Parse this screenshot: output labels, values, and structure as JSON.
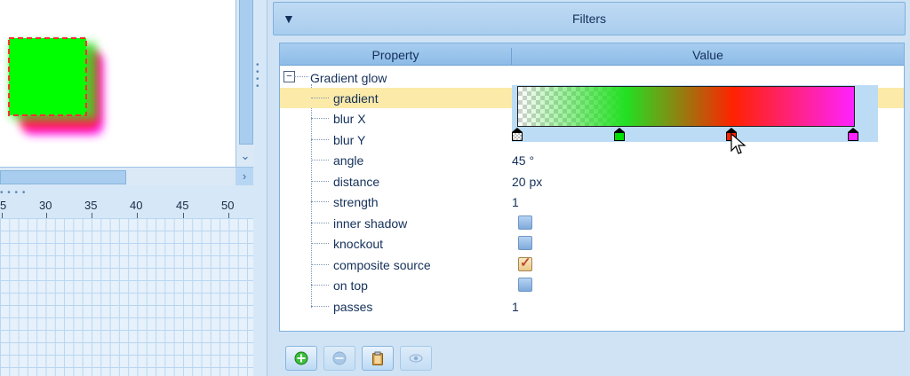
{
  "canvas": {
    "rect_fill": "#00ff00",
    "rect_border": "#ff3030",
    "glow_colors": [
      "#00ff00",
      "#ff2200",
      "#ff22ff"
    ]
  },
  "ruler": {
    "ticks": [
      "5",
      "30",
      "35",
      "40",
      "45",
      "50"
    ]
  },
  "filters_panel": {
    "title": "Filters",
    "collapse_icon": "triangle-down-icon"
  },
  "table": {
    "columns": [
      "Property",
      "Value"
    ],
    "group": {
      "label": "Gradient glow",
      "toggle": "−"
    },
    "rows": [
      {
        "label": "gradient",
        "value": "",
        "selected": true
      },
      {
        "label": "blur X",
        "value": ""
      },
      {
        "label": "blur Y",
        "value": ""
      },
      {
        "label": "angle",
        "value": "45 °"
      },
      {
        "label": "distance",
        "value": "20 px"
      },
      {
        "label": "strength",
        "value": "1"
      },
      {
        "label": "inner shadow",
        "checkbox": false
      },
      {
        "label": "knockout",
        "checkbox": false
      },
      {
        "label": "composite source",
        "checkbox": true
      },
      {
        "label": "on top",
        "checkbox": false
      },
      {
        "label": "passes",
        "value": "1"
      }
    ]
  },
  "gradient_editor": {
    "stops": [
      {
        "color": "transparent",
        "position": 0.0
      },
      {
        "color": "#00e000",
        "position": 0.32
      },
      {
        "color": "#ff2200",
        "position": 0.64
      },
      {
        "color": "#ff22ff",
        "position": 1.0
      }
    ]
  },
  "toolbar": {
    "buttons": [
      {
        "name": "add-filter-button",
        "icon": "plus-circle-icon",
        "enabled": true
      },
      {
        "name": "remove-filter-button",
        "icon": "minus-circle-icon",
        "enabled": false
      },
      {
        "name": "paste-filter-button",
        "icon": "clipboard-icon",
        "enabled": true
      },
      {
        "name": "toggle-visibility-button",
        "icon": "eye-icon",
        "enabled": false
      }
    ]
  }
}
